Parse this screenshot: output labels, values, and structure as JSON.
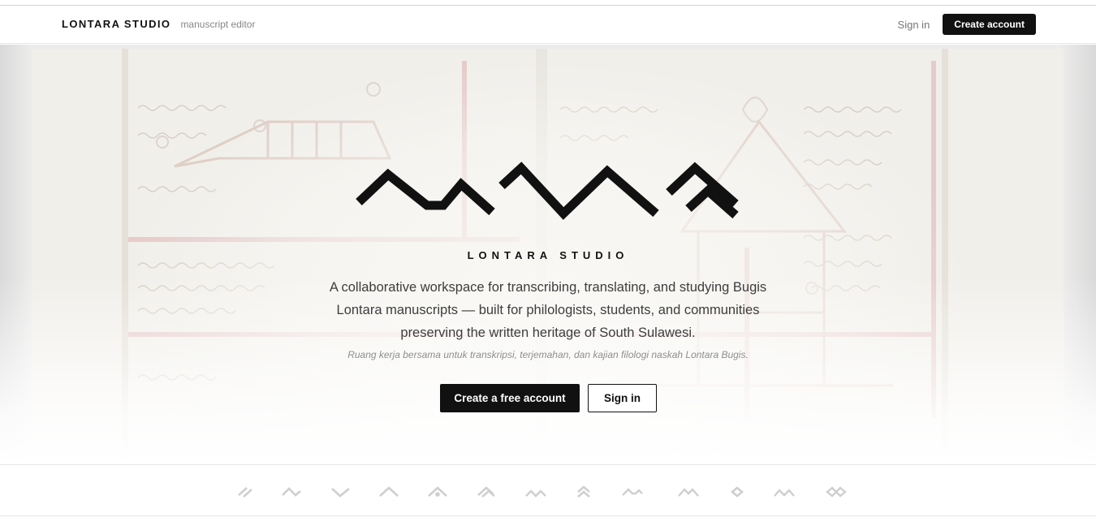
{
  "header": {
    "brand_name": "LONTARA STUDIO",
    "brand_tag": "manuscript editor",
    "sign_in": "Sign in",
    "create_account": "Create account"
  },
  "hero": {
    "wordmark": "LONTARA STUDIO",
    "tagline": "A collaborative workspace for transcribing, translating, and studying Bugis Lontara manuscripts — built for philologists, students, and communities preserving the written heritage of South Sulawesi.",
    "tagline_id": "Ruang kerja bersama untuk transkripsi, terjemahan, dan kajian filologi naskah Lontara Bugis.",
    "primary_cta": "Create a free account",
    "secondary_cta": "Sign in",
    "background": "lontara-manuscript-illustration",
    "logo": "lontara-script-logo"
  },
  "glyph_strip": {
    "glyphs": [
      "ka-glyph",
      "ga-glyph",
      "nga-glyph",
      "ngka-glyph",
      "pa-glyph",
      "ba-glyph",
      "ma-glyph",
      "mpa-glyph",
      "ta-glyph",
      "da-glyph",
      "na-glyph",
      "nra-glyph",
      "ca-glyph"
    ],
    "color": "#cfcfcf"
  },
  "colors": {
    "accent": "#111111",
    "muted": "#888888",
    "manuscript_red": "#c9a0a0"
  }
}
